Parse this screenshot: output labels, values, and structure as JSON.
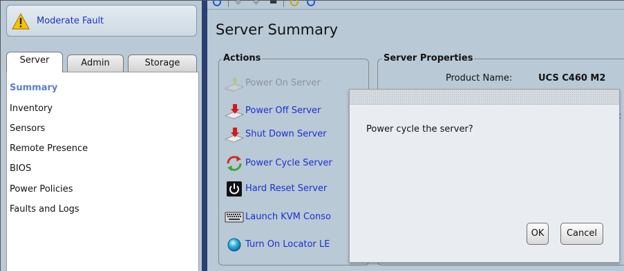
{
  "fault": {
    "label": "Moderate Fault",
    "icon": "warning-triangle-icon",
    "color": "#f5c500"
  },
  "tabs": [
    {
      "label": "Server",
      "active": true
    },
    {
      "label": "Admin",
      "active": false
    },
    {
      "label": "Storage",
      "active": false
    }
  ],
  "nav": [
    {
      "label": "Summary",
      "active": true
    },
    {
      "label": "Inventory",
      "active": false
    },
    {
      "label": "Sensors",
      "active": false
    },
    {
      "label": "Remote Presence",
      "active": false
    },
    {
      "label": "BIOS",
      "active": false
    },
    {
      "label": "Power Policies",
      "active": false
    },
    {
      "label": "Faults and Logs",
      "active": false
    }
  ],
  "page": {
    "title": "Server Summary"
  },
  "actions": {
    "title": "Actions",
    "items": [
      {
        "label": "Power On Server",
        "icon": "power-on-server-icon",
        "enabled": false
      },
      {
        "label": "Power Off Server",
        "icon": "power-off-server-icon",
        "enabled": true
      },
      {
        "label": "Shut Down Server",
        "icon": "shut-down-server-icon",
        "enabled": true
      },
      {
        "label": "Power Cycle Server",
        "icon": "power-cycle-icon",
        "enabled": true
      },
      {
        "label": "Hard Reset Server",
        "icon": "hard-reset-icon",
        "enabled": true
      },
      {
        "label": "Launch KVM Conso",
        "icon": "keyboard-icon",
        "enabled": true
      },
      {
        "label": "Turn On Locator LE",
        "icon": "locator-led-icon",
        "enabled": true
      }
    ]
  },
  "properties": {
    "title": "Server Properties",
    "product_name_label": "Product Name:",
    "product_name_value": "UCS C460 M2"
  },
  "dialog": {
    "message": "Power cycle the server?",
    "ok_label": "OK",
    "cancel_label": "Cancel"
  },
  "colors": {
    "link": "#1a2fd3",
    "nav_active": "#5a7fd0",
    "panel_bg": "#b9c9d6",
    "splitter": "#2b3f73"
  }
}
